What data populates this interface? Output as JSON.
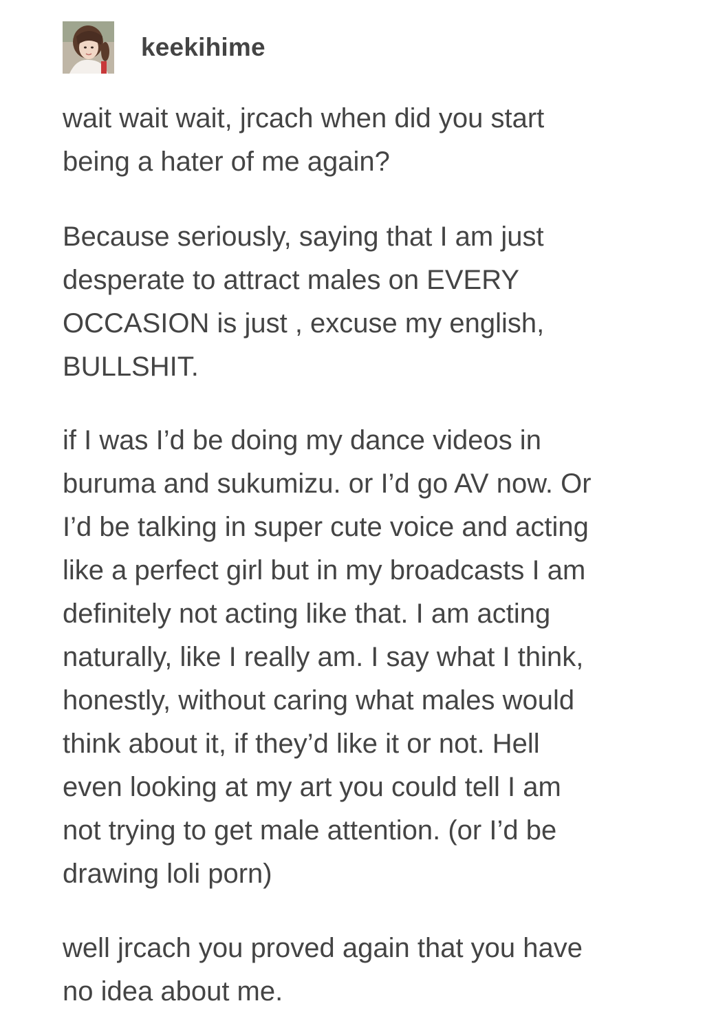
{
  "post": {
    "author": {
      "username": "keekihime",
      "avatar": "profile-photo"
    },
    "paragraphs": [
      "wait wait wait, jrcach when did you start\nbeing a hater of me again?",
      "Because seriously, saying that I am just\ndesperate to attract males on EVERY\nOCCASION is just , excuse my english,\nBULLSHIT.",
      "if I was I’d be doing my dance videos in\nburuma and sukumizu. or I’d go AV now. Or\nI’d be talking in super cute voice and acting\nlike a perfect girl but in my broadcasts I am\ndefinitely not acting like that. I am acting\nnaturally, like I really am. I say what I think,\nhonestly, without caring what males would\nthink about it, if they’d like it or not. Hell\neven looking at my art you could tell I am\nnot trying to get male attention. (or I’d be\ndrawing loli porn)",
      "well jrcach you proved again that you have\nno idea about me."
    ]
  },
  "colors": {
    "text": "#444444",
    "background": "#ffffff"
  }
}
